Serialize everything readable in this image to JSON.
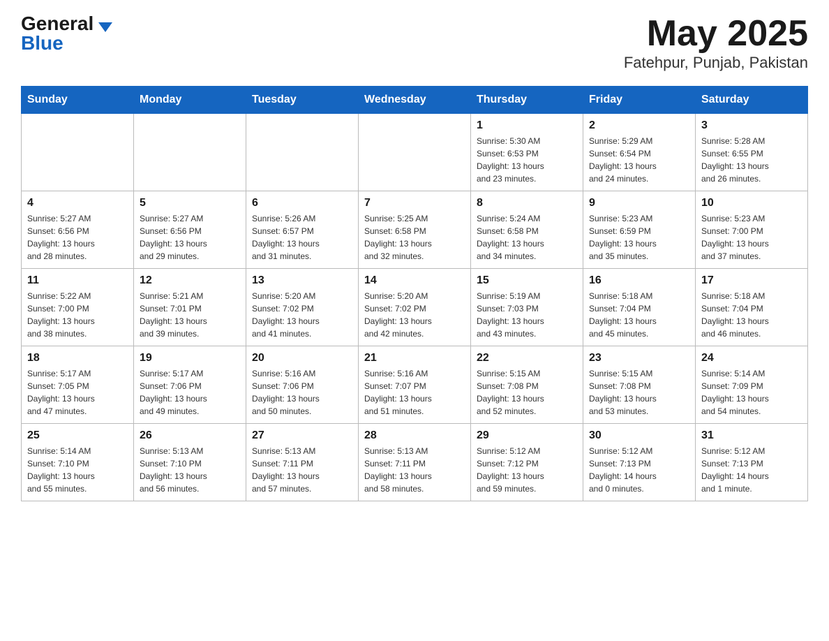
{
  "header": {
    "logo_general": "General",
    "logo_blue": "Blue",
    "month_title": "May 2025",
    "location": "Fatehpur, Punjab, Pakistan"
  },
  "weekdays": [
    "Sunday",
    "Monday",
    "Tuesday",
    "Wednesday",
    "Thursday",
    "Friday",
    "Saturday"
  ],
  "weeks": [
    [
      {
        "day": "",
        "info": ""
      },
      {
        "day": "",
        "info": ""
      },
      {
        "day": "",
        "info": ""
      },
      {
        "day": "",
        "info": ""
      },
      {
        "day": "1",
        "info": "Sunrise: 5:30 AM\nSunset: 6:53 PM\nDaylight: 13 hours\nand 23 minutes."
      },
      {
        "day": "2",
        "info": "Sunrise: 5:29 AM\nSunset: 6:54 PM\nDaylight: 13 hours\nand 24 minutes."
      },
      {
        "day": "3",
        "info": "Sunrise: 5:28 AM\nSunset: 6:55 PM\nDaylight: 13 hours\nand 26 minutes."
      }
    ],
    [
      {
        "day": "4",
        "info": "Sunrise: 5:27 AM\nSunset: 6:56 PM\nDaylight: 13 hours\nand 28 minutes."
      },
      {
        "day": "5",
        "info": "Sunrise: 5:27 AM\nSunset: 6:56 PM\nDaylight: 13 hours\nand 29 minutes."
      },
      {
        "day": "6",
        "info": "Sunrise: 5:26 AM\nSunset: 6:57 PM\nDaylight: 13 hours\nand 31 minutes."
      },
      {
        "day": "7",
        "info": "Sunrise: 5:25 AM\nSunset: 6:58 PM\nDaylight: 13 hours\nand 32 minutes."
      },
      {
        "day": "8",
        "info": "Sunrise: 5:24 AM\nSunset: 6:58 PM\nDaylight: 13 hours\nand 34 minutes."
      },
      {
        "day": "9",
        "info": "Sunrise: 5:23 AM\nSunset: 6:59 PM\nDaylight: 13 hours\nand 35 minutes."
      },
      {
        "day": "10",
        "info": "Sunrise: 5:23 AM\nSunset: 7:00 PM\nDaylight: 13 hours\nand 37 minutes."
      }
    ],
    [
      {
        "day": "11",
        "info": "Sunrise: 5:22 AM\nSunset: 7:00 PM\nDaylight: 13 hours\nand 38 minutes."
      },
      {
        "day": "12",
        "info": "Sunrise: 5:21 AM\nSunset: 7:01 PM\nDaylight: 13 hours\nand 39 minutes."
      },
      {
        "day": "13",
        "info": "Sunrise: 5:20 AM\nSunset: 7:02 PM\nDaylight: 13 hours\nand 41 minutes."
      },
      {
        "day": "14",
        "info": "Sunrise: 5:20 AM\nSunset: 7:02 PM\nDaylight: 13 hours\nand 42 minutes."
      },
      {
        "day": "15",
        "info": "Sunrise: 5:19 AM\nSunset: 7:03 PM\nDaylight: 13 hours\nand 43 minutes."
      },
      {
        "day": "16",
        "info": "Sunrise: 5:18 AM\nSunset: 7:04 PM\nDaylight: 13 hours\nand 45 minutes."
      },
      {
        "day": "17",
        "info": "Sunrise: 5:18 AM\nSunset: 7:04 PM\nDaylight: 13 hours\nand 46 minutes."
      }
    ],
    [
      {
        "day": "18",
        "info": "Sunrise: 5:17 AM\nSunset: 7:05 PM\nDaylight: 13 hours\nand 47 minutes."
      },
      {
        "day": "19",
        "info": "Sunrise: 5:17 AM\nSunset: 7:06 PM\nDaylight: 13 hours\nand 49 minutes."
      },
      {
        "day": "20",
        "info": "Sunrise: 5:16 AM\nSunset: 7:06 PM\nDaylight: 13 hours\nand 50 minutes."
      },
      {
        "day": "21",
        "info": "Sunrise: 5:16 AM\nSunset: 7:07 PM\nDaylight: 13 hours\nand 51 minutes."
      },
      {
        "day": "22",
        "info": "Sunrise: 5:15 AM\nSunset: 7:08 PM\nDaylight: 13 hours\nand 52 minutes."
      },
      {
        "day": "23",
        "info": "Sunrise: 5:15 AM\nSunset: 7:08 PM\nDaylight: 13 hours\nand 53 minutes."
      },
      {
        "day": "24",
        "info": "Sunrise: 5:14 AM\nSunset: 7:09 PM\nDaylight: 13 hours\nand 54 minutes."
      }
    ],
    [
      {
        "day": "25",
        "info": "Sunrise: 5:14 AM\nSunset: 7:10 PM\nDaylight: 13 hours\nand 55 minutes."
      },
      {
        "day": "26",
        "info": "Sunrise: 5:13 AM\nSunset: 7:10 PM\nDaylight: 13 hours\nand 56 minutes."
      },
      {
        "day": "27",
        "info": "Sunrise: 5:13 AM\nSunset: 7:11 PM\nDaylight: 13 hours\nand 57 minutes."
      },
      {
        "day": "28",
        "info": "Sunrise: 5:13 AM\nSunset: 7:11 PM\nDaylight: 13 hours\nand 58 minutes."
      },
      {
        "day": "29",
        "info": "Sunrise: 5:12 AM\nSunset: 7:12 PM\nDaylight: 13 hours\nand 59 minutes."
      },
      {
        "day": "30",
        "info": "Sunrise: 5:12 AM\nSunset: 7:13 PM\nDaylight: 14 hours\nand 0 minutes."
      },
      {
        "day": "31",
        "info": "Sunrise: 5:12 AM\nSunset: 7:13 PM\nDaylight: 14 hours\nand 1 minute."
      }
    ]
  ]
}
